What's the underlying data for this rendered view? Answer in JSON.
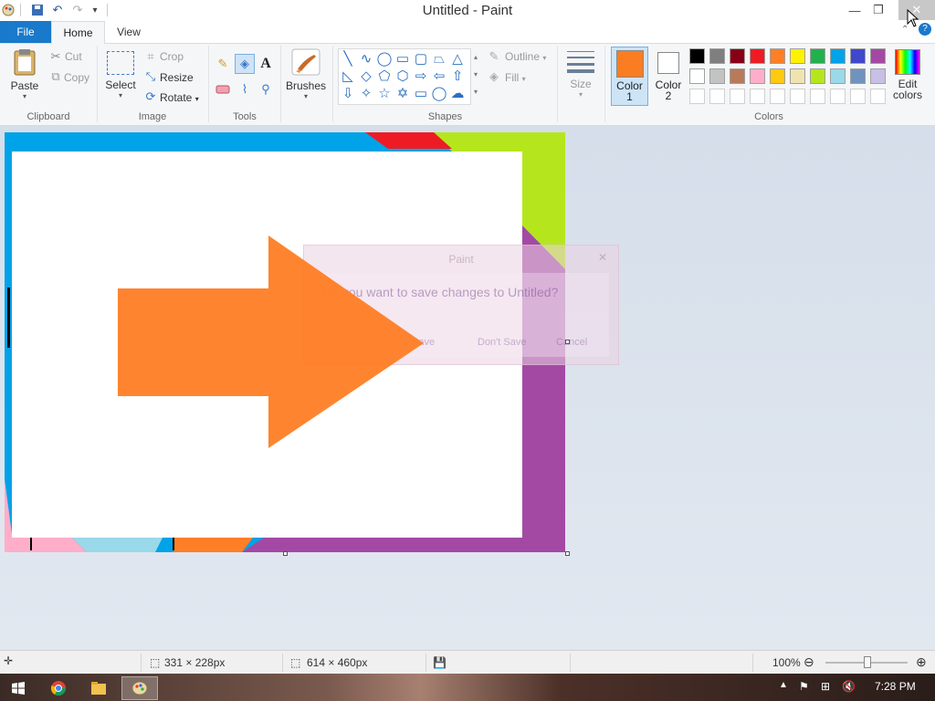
{
  "window": {
    "title": "Untitled - Paint",
    "minimize_icon": "minimize-icon",
    "restore_icon": "restore-icon",
    "close_icon": "close-icon"
  },
  "tabs": [
    {
      "label": "File"
    },
    {
      "label": "Home"
    },
    {
      "label": "View"
    }
  ],
  "ribbon": {
    "clipboard": {
      "label": "Clipboard",
      "paste": "Paste",
      "cut": "Cut",
      "copy": "Copy"
    },
    "image": {
      "label": "Image",
      "select": "Select",
      "crop": "Crop",
      "resize": "Resize",
      "rotate": "Rotate"
    },
    "tools": {
      "label": "Tools"
    },
    "brushes": {
      "label": "Brushes"
    },
    "shapes": {
      "label": "Shapes",
      "outline": "Outline",
      "fill": "Fill"
    },
    "size": {
      "label": "Size"
    },
    "color1": {
      "label": "Color",
      "num": "1",
      "value": "#fa7d22"
    },
    "color2": {
      "label": "Color",
      "num": "2",
      "value": "#ffffff"
    },
    "colors": {
      "label": "Colors",
      "edit_label_1": "Edit",
      "edit_label_2": "colors"
    },
    "palette_row1": [
      "#000000",
      "#7f7f7f",
      "#880015",
      "#ed1c24",
      "#ff7f27",
      "#fff200",
      "#22b14c",
      "#00a2e8",
      "#3f48cc",
      "#a349a4"
    ],
    "palette_row2": [
      "#ffffff",
      "#c3c3c3",
      "#b97a57",
      "#ffaec9",
      "#ffc90e",
      "#efe4b0",
      "#b5e61d",
      "#99d9ea",
      "#7092be",
      "#c8bfe7"
    ]
  },
  "dialog": {
    "title": "Paint",
    "message": "Do you want to save changes to Untitled?",
    "save": "Save",
    "dont_save": "Don't Save",
    "cancel": "Cancel"
  },
  "status": {
    "cursor_pos": "",
    "selection_size": "331 × 228px",
    "canvas_size": "614 × 460px",
    "zoom": "100%"
  },
  "taskbar": {
    "time": "7:28 PM"
  }
}
